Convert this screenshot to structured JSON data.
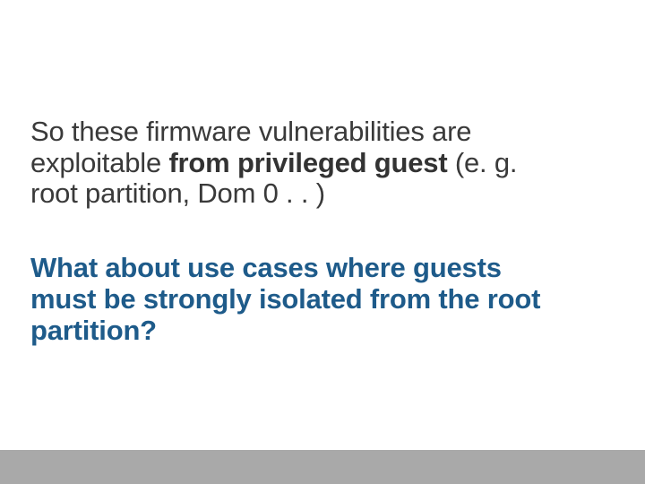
{
  "slide": {
    "para1": {
      "before": "So these firmware vulnerabilities are exploitable ",
      "bold": "from privileged guest",
      "after": " (e. g. root partition, Dom 0 . . )"
    },
    "para2": "What about use cases where guests must be strongly isolated from the root partition?"
  },
  "colors": {
    "body_text": "#3a3a3a",
    "emphasis_text": "#1e5b8a",
    "footer_bar": "#a9a9a9",
    "background": "#ffffff"
  }
}
